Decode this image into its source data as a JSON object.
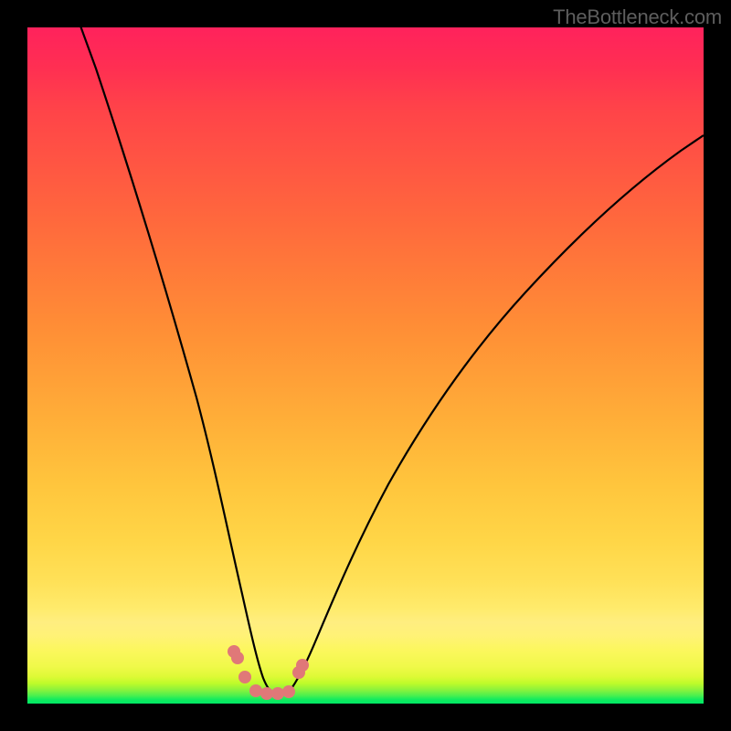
{
  "watermark_text": "TheBottleneck.com",
  "colors": {
    "curve_stroke": "#000000",
    "marker_fill": "#e57373",
    "background": "#000000"
  },
  "chart_data": {
    "type": "line",
    "title": "",
    "xlabel": "",
    "ylabel": "",
    "xlim": [
      0,
      100
    ],
    "ylim": [
      0,
      100
    ],
    "series": [
      {
        "name": "bottleneck-curve",
        "x": [
          0,
          5,
          10,
          15,
          20,
          25,
          28,
          30,
          32,
          34,
          35,
          36,
          38,
          40,
          45,
          50,
          55,
          60,
          65,
          70,
          75,
          80,
          85,
          90,
          95,
          100
        ],
        "values": [
          120,
          103,
          86,
          69,
          52,
          34,
          22,
          14,
          7,
          3,
          2,
          2,
          3,
          6,
          18,
          30,
          40,
          48,
          55,
          61,
          66,
          71,
          75,
          78.5,
          81.5,
          84
        ]
      }
    ],
    "markers": {
      "name": "salmon-dots",
      "points": [
        {
          "x": 28,
          "y": 7
        },
        {
          "x": 29,
          "y": 6
        },
        {
          "x": 30,
          "y": 3
        },
        {
          "x": 32.5,
          "y": 2
        },
        {
          "x": 34,
          "y": 2
        },
        {
          "x": 36,
          "y": 2
        },
        {
          "x": 37.5,
          "y": 2
        },
        {
          "x": 39,
          "y": 6
        },
        {
          "x": 39.5,
          "y": 7
        }
      ]
    },
    "gradient_stops": [
      {
        "pos": 0,
        "color": "#00e864"
      },
      {
        "pos": 12,
        "color": "#ffee80"
      },
      {
        "pos": 50,
        "color": "#ffae38"
      },
      {
        "pos": 100,
        "color": "#ff225c"
      }
    ]
  }
}
